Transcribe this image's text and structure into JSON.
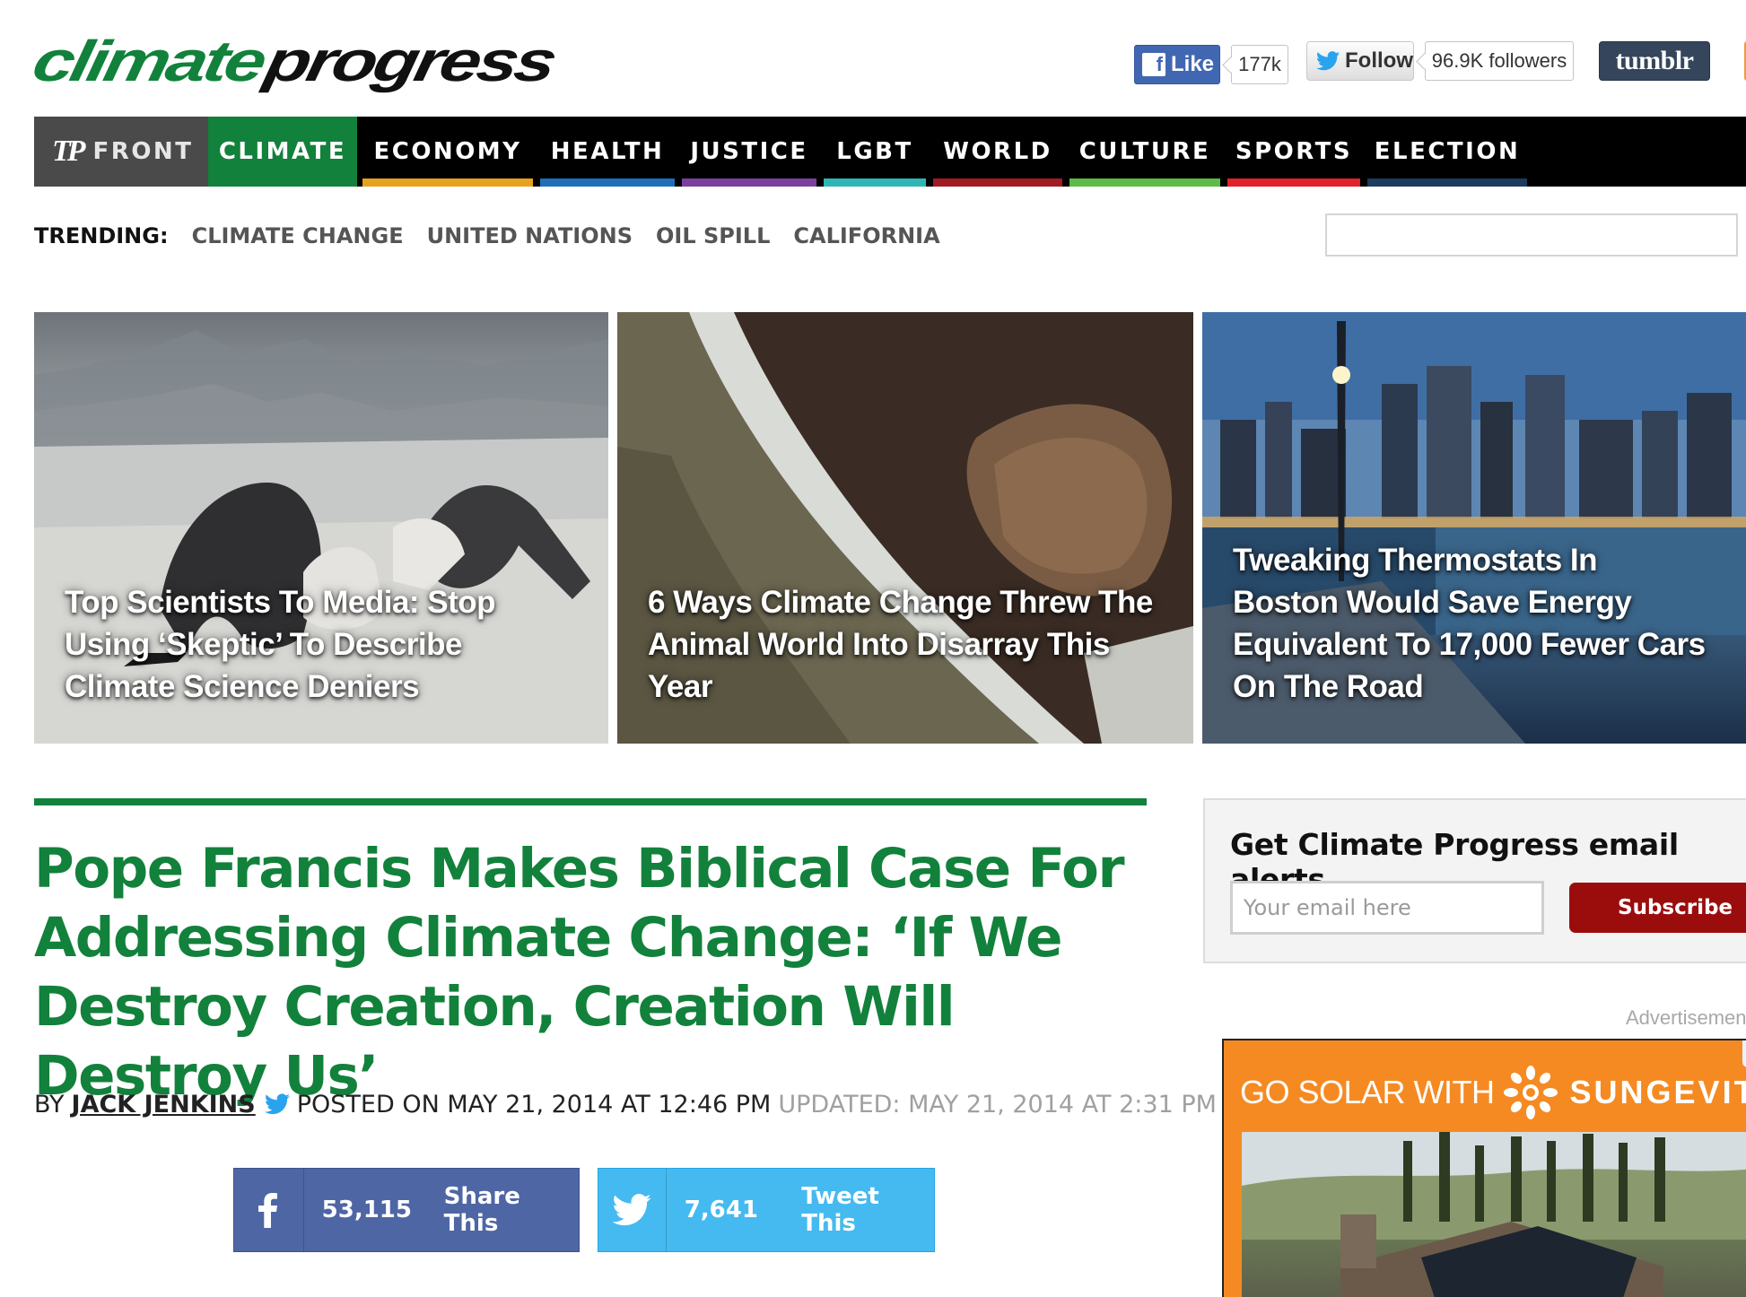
{
  "logo": {
    "part1": "climate",
    "part2": "progress"
  },
  "social": {
    "fb_like_label": "Like",
    "fb_like_count": "177k",
    "twitter_follow_label": "Follow",
    "twitter_followers": "96.9K followers",
    "tumblr_label": "tumblr"
  },
  "nav": {
    "items": [
      {
        "label": "FRONT",
        "color": "#4a4a4a"
      },
      {
        "label": "CLIMATE",
        "color": "#12813b"
      },
      {
        "label": "ECONOMY",
        "color": "#e5a21f"
      },
      {
        "label": "HEALTH",
        "color": "#1f6fb8"
      },
      {
        "label": "JUSTICE",
        "color": "#7b3fa0"
      },
      {
        "label": "LGBT",
        "color": "#2fb5b5"
      },
      {
        "label": "WORLD",
        "color": "#a31b22"
      },
      {
        "label": "CULTURE",
        "color": "#5dbb46"
      },
      {
        "label": "SPORTS",
        "color": "#e0222a"
      },
      {
        "label": "ELECTION",
        "color": "#1c3b5e"
      }
    ]
  },
  "trending": {
    "label": "TRENDING:",
    "topics": [
      "CLIMATE CHANGE",
      "UNITED NATIONS",
      "OIL SPILL",
      "CALIFORNIA"
    ]
  },
  "featured": [
    {
      "title": "Top Scientists To Media: Stop Using ‘Skeptic’ To Describe Climate Science Deniers"
    },
    {
      "title": "6 Ways Climate Change Threw The Animal World Into Disarray This Year"
    },
    {
      "title": "Tweaking Thermostats In Boston Would Save Energy Equivalent To 17,000 Fewer Cars On The Road"
    }
  ],
  "article": {
    "headline": "Pope Francis Makes Biblical Case For Addressing Climate Change: ‘If We Destroy Creation, Creation Will Destroy Us’",
    "by": "BY",
    "author": "JACK JENKINS",
    "posted": "POSTED ON MAY 21, 2014 AT 12:46 PM",
    "updated": "UPDATED: MAY 21, 2014 AT 2:31 PM"
  },
  "share": {
    "facebook_count": "53,115",
    "facebook_label": "Share This",
    "twitter_count": "7,641",
    "twitter_label": "Tweet This"
  },
  "sidebar": {
    "alerts_title": "Get Climate Progress email alerts",
    "email_placeholder": "Your email here",
    "subscribe_label": "Subscribe",
    "advertisement_label": "Advertisement",
    "ad_text": "GO SOLAR WITH",
    "ad_brand": "SUNGEVITY"
  },
  "colors": {
    "brand_green": "#12813b",
    "facebook_blue": "#4f66a5",
    "twitter_blue": "#45baf0",
    "subscribe_red": "#9b0d0d",
    "ad_orange": "#f58a22"
  }
}
